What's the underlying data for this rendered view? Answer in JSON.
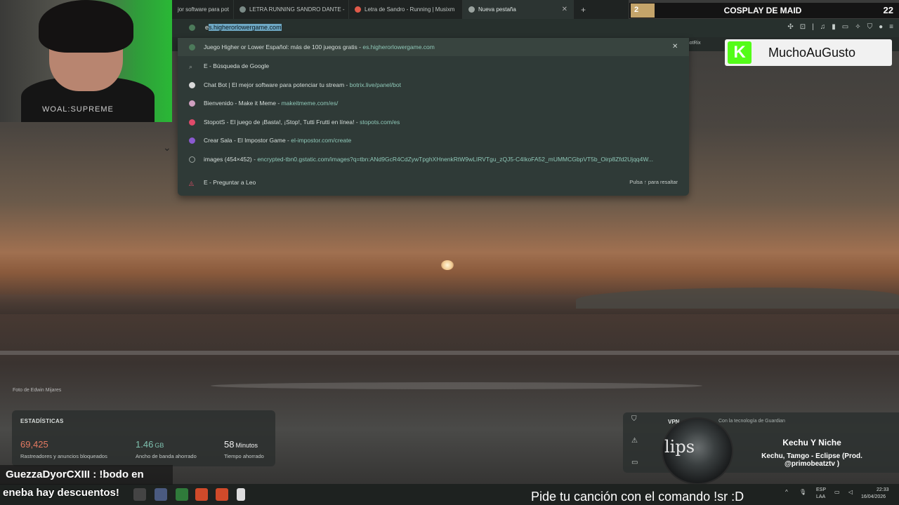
{
  "browser": {
    "tabs": [
      {
        "label": "jor software para pot",
        "active": false
      },
      {
        "label": "LETRA RUNNING SANDRO DANTE -",
        "active": false
      },
      {
        "label": "Letra de Sandro - Running | Musixm",
        "active": false
      },
      {
        "label": "Nueva pestaña",
        "active": true
      }
    ],
    "omnibox": {
      "prefix": "e",
      "selected": "s.higherorlowergame.com"
    },
    "bookmark_label": "BotRix"
  },
  "suggestions": [
    {
      "text": "Juego Higher or Lower Español: más de 100 juegos gratis",
      "url": "es.higherorlowergame.com",
      "color": "#4c7a5a"
    },
    {
      "text": "E - Búsqueda de Google",
      "url": "",
      "color": "#9aa39f"
    },
    {
      "text": "Chat Bot | El mejor software para potenciar tu stream",
      "url": "botrix.live/panel/bot",
      "color": "#d9d9d9"
    },
    {
      "text": "Bienvenido - Make it Meme",
      "url": "makeitmeme.com/es/",
      "color": "#cfa0c0"
    },
    {
      "text": "StopotS - El juego de ¡Basta!, ¡Stop!, Tutti Frutti en línea!",
      "url": "stopots.com/es",
      "color": "#e04a6a"
    },
    {
      "text": "Crear Sala - El Impostor Game",
      "url": "el-impostor.com/create",
      "color": "#8a5ad0"
    },
    {
      "text": "images (454×452)",
      "url": "encrypted-tbn0.gstatic.com/images?q=tbn:ANd9GcR4CdZywTpghXHnenkRtW9wLIRVTgu_zQJ5-C4IkoFA52_mUMMCGbpVT5b_Oirp8Zfd2Ujqq4W...",
      "color": "#9aa39f"
    },
    {
      "text": "E - Preguntar a Leo",
      "url": "",
      "color": "#e0506a"
    }
  ],
  "suggestion_hint": "Pulsa ↑ para resaltar",
  "stream": {
    "goal_count_left": "2",
    "goal_title": "COSPLAY DE MAID",
    "goal_count_right": "22",
    "kick_user": "MuchoAuGusto",
    "chat_user_line": "GuezzaDyorCXIII : !bodo en",
    "chat_line2": "eneba hay descuentos!",
    "song_request": "Pide tu canción con el comando !sr :D"
  },
  "webcam": {
    "shirt_text": "WOAL:SUPREME"
  },
  "photo_credit": "Foto de Edwin Mijares",
  "stats": {
    "title": "ESTADÍSTICAS",
    "items": [
      {
        "value": "69,425",
        "unit": "",
        "label": "Rastreadores y anuncios bloqueados",
        "color": "#e57a62"
      },
      {
        "value": "1.46",
        "unit": "GB",
        "label": "Ancho de banda ahorrado",
        "color": "#7fc2b0"
      },
      {
        "value": "58",
        "unit": "Minutos",
        "label": "Tiempo ahorrado",
        "color": "#f0f0f0"
      }
    ]
  },
  "vpn": {
    "label": "VPN",
    "sub": "Con la tecnología de Guardian"
  },
  "now_playing": {
    "title": "Kechu Y Niche",
    "subtitle": "Kechu, Tamgo - Eclipse (Prod. @primobeatztv )",
    "disc_text": "lips"
  },
  "taskbar": {
    "lang1": "ESP",
    "lang2": "LAA",
    "time": "22:33",
    "date": "16/04/2026"
  }
}
